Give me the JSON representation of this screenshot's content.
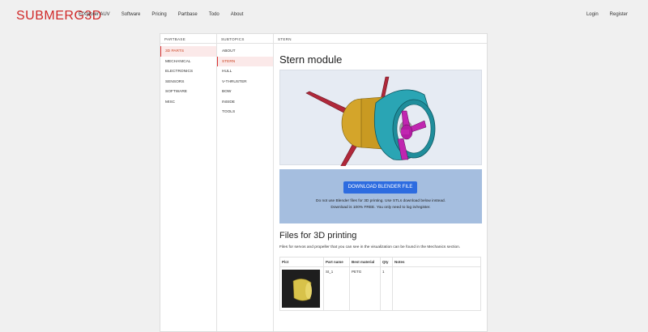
{
  "header": {
    "brand": "SUBMERG3D",
    "nav": [
      "E/Xplorer AUV",
      "Software",
      "Pricing",
      "Partbase",
      "Todo",
      "About"
    ],
    "auth": [
      "Login",
      "Register"
    ]
  },
  "columns": {
    "partbase": {
      "heading": "PARTBASE",
      "items": [
        "3D PARTS",
        "MECHANICAL",
        "ELECTRONICS",
        "SENSORS",
        "SOFTWARE",
        "MISC"
      ],
      "active": "3D PARTS"
    },
    "subtopics": {
      "heading": "SUBTOPICS",
      "items": [
        "ABOUT",
        "STERN",
        "HULL",
        "V-THRUSTER",
        "BOW",
        "INSIDE",
        "TOOLS"
      ],
      "active": "STERN"
    },
    "detail": {
      "heading": "STERN"
    }
  },
  "content": {
    "title": "Stern module",
    "download_button": "DOWNLOAD BLENDER FILE",
    "download_note_1": "Do not use Blender files for 3D printing. Use STLs download below instead.",
    "download_note_2": "Download is 100% FREE. You only need to log in/register.",
    "files_title": "Files for 3D printing",
    "files_desc": "Files for servos and propeller that you can see in the visualization can be found in the Mechanics section.",
    "table": {
      "headers": [
        "Pict",
        "Part name",
        "Best material",
        "Qty",
        "Notes"
      ],
      "rows": [
        {
          "part": "St_1",
          "material": "PETG",
          "qty": "1",
          "notes": ""
        }
      ]
    }
  },
  "colors": {
    "brand": "#d02828",
    "download_bg": "#a5bedf",
    "button": "#2d6ce0",
    "viz_bg": "#e6ebf3"
  }
}
